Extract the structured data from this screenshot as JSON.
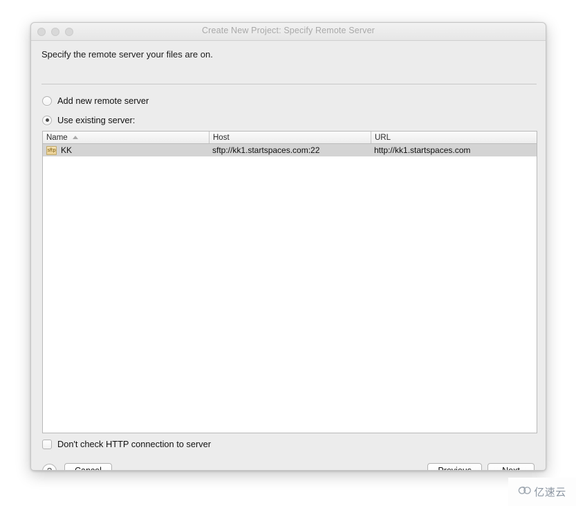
{
  "window": {
    "title": "Create New Project: Specify Remote Server",
    "traffic_lights": [
      "close-button",
      "minimize-button",
      "zoom-button"
    ]
  },
  "intro": {
    "text": "Specify the remote server your files are on."
  },
  "options": {
    "add_new_label": "Add new remote server",
    "add_new_selected": false,
    "use_existing_label": "Use existing server:",
    "use_existing_selected": true
  },
  "server_list": {
    "columns": [
      "Name",
      "Host",
      "URL"
    ],
    "sort_column": "Name",
    "sort_direction": "ascending",
    "rows": [
      {
        "icon": "sftp-icon",
        "icon_label": "sftp",
        "name": "KK",
        "host": "sftp://kk1.startspaces.com:22",
        "url": "http://kk1.startspaces.com",
        "selected": true
      }
    ]
  },
  "bottom_option": {
    "label": "Don't check HTTP connection to server",
    "checked": false
  },
  "footer": {
    "help_label": "?",
    "cancel_label": "Cancel",
    "previous_label": "Previous",
    "next_label": "Next"
  },
  "watermark": {
    "icon": "cloud-icon",
    "text": "亿速云"
  },
  "colors": {
    "dialog_background": "#ececec",
    "list_background": "#ffffff",
    "selected_row": "#d4d4d4",
    "title_text": "#a9a9a9",
    "body_text": "#1b1b1b"
  }
}
